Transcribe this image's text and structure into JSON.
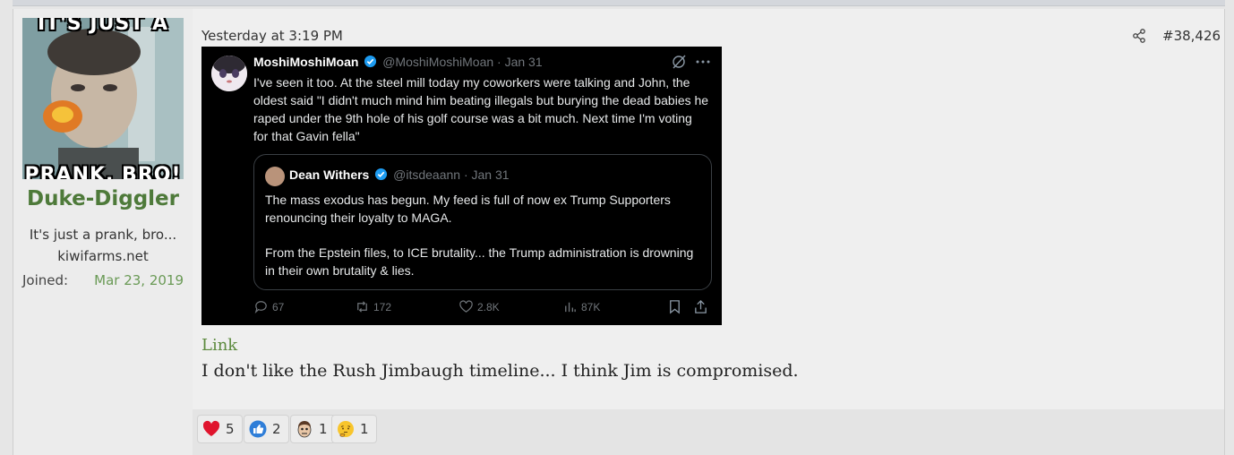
{
  "post": {
    "date": "Yesterday at 3:19 PM",
    "number": "#38,426",
    "link_text": "Link",
    "body": "I don't like the Rush Jimbaugh timeline... I think Jim is compromised."
  },
  "user": {
    "avatar_top_text": "IT'S JUST A",
    "avatar_bottom_text": "PRANK, BRO!",
    "name": "Duke-Diggler",
    "title": "It's just a prank, bro...",
    "site": "kiwifarms.net",
    "joined_label": "Joined:",
    "joined_date": "Mar 23, 2019"
  },
  "tweet": {
    "name": "MoshiMoshiMoan",
    "handle": "@MoshiMoshiMoan · Jan 31",
    "text": "I've seen it too. At the steel mill today my coworkers were talking and John, the oldest said \"I didn't much mind him beating illegals but burying the dead babies he raped under the 9th hole of his golf course was a bit much. Next time I'm voting for that Gavin fella\"",
    "quote": {
      "name": "Dean Withers",
      "handle": "@itsdeaann · Jan 31",
      "text1": "The mass exodus has begun. My feed is full of now ex Trump Supporters renouncing their loyalty to MAGA.",
      "text2": "From the Epstein files, to ICE brutality... the Trump administration is drowning in their own brutality & lies."
    },
    "stats": {
      "replies": "67",
      "reposts": "172",
      "likes": "2.8K",
      "views": "87K"
    }
  },
  "reactions": [
    {
      "icon": "heart-icon",
      "count": "5"
    },
    {
      "icon": "thumbs-up-icon",
      "count": "2"
    },
    {
      "icon": "face-emoji-icon",
      "count": "1"
    },
    {
      "icon": "thinking-emoji-icon",
      "count": "1"
    }
  ],
  "colors": {
    "username": "#4e7a3a",
    "joined_date": "#6a9a56",
    "link": "#5c8a3e",
    "verified": "#1d9bf0"
  }
}
